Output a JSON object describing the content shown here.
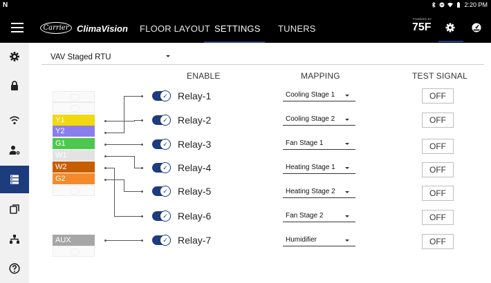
{
  "status_bar": {
    "time": "2:20 PM",
    "icons": [
      "n-logo-icon",
      "bluetooth-icon",
      "minus-circle-icon",
      "wifi-icon",
      "battery-icon"
    ]
  },
  "app_bar": {
    "carrier_logo": "Carrier",
    "brand": "ClimaVision",
    "tabs": [
      {
        "label": "FLOOR LAYOUT",
        "active": false
      },
      {
        "label": "SETTINGS",
        "active": true
      },
      {
        "label": "TUNERS",
        "active": false
      }
    ],
    "powered_by": "POWERED BY",
    "logo_75f": "75F",
    "icons": [
      "hamburger-menu-icon",
      "gear-icon",
      "gauge-icon"
    ]
  },
  "sidebar": {
    "items": [
      {
        "icon": "gear-icon",
        "active": false
      },
      {
        "icon": "lock-icon",
        "active": false
      },
      {
        "icon": "wifi-icon",
        "active": false
      },
      {
        "icon": "user-settings-icon",
        "active": false
      },
      {
        "icon": "equipment-list-icon",
        "active": true
      },
      {
        "icon": "copy-icon",
        "active": false
      },
      {
        "icon": "network-icon",
        "active": false
      },
      {
        "icon": "help-icon",
        "active": false
      }
    ]
  },
  "equipment": {
    "selected": "VAV Staged RTU"
  },
  "columns": {
    "enable": "ENABLE",
    "mapping": "MAPPING",
    "test_signal": "TEST SIGNAL"
  },
  "terminals": [
    {
      "label": "Y1",
      "color": "#f2d80f"
    },
    {
      "label": "Y2",
      "color": "#8a7df0"
    },
    {
      "label": "G1",
      "color": "#4cc94c"
    },
    {
      "label": "W1",
      "color": "#e3e3e3"
    },
    {
      "label": "W2",
      "color": "#c75e00"
    },
    {
      "label": "G2",
      "color": "#f48a2a"
    },
    {
      "label": "AUX",
      "color": "#a6a6a6"
    }
  ],
  "relays": [
    {
      "label": "Relay-1",
      "enabled": true,
      "mapping": "Cooling Stage 1",
      "test": "OFF"
    },
    {
      "label": "Relay-2",
      "enabled": true,
      "mapping": "Cooling Stage 2",
      "test": "OFF"
    },
    {
      "label": "Relay-3",
      "enabled": true,
      "mapping": "Fan Stage 1",
      "test": "OFF"
    },
    {
      "label": "Relay-4",
      "enabled": true,
      "mapping": "Heating Stage 1",
      "test": "OFF"
    },
    {
      "label": "Relay-5",
      "enabled": true,
      "mapping": "Heating Stage 2",
      "test": "OFF"
    },
    {
      "label": "Relay-6",
      "enabled": true,
      "mapping": "Fan Stage 2",
      "test": "OFF"
    },
    {
      "label": "Relay-7",
      "enabled": true,
      "mapping": "Humidifier",
      "test": "OFF"
    }
  ],
  "colors": {
    "accent": "#1d3c7e",
    "appbar": "#000000",
    "sidebar": "#f1f1f1"
  }
}
